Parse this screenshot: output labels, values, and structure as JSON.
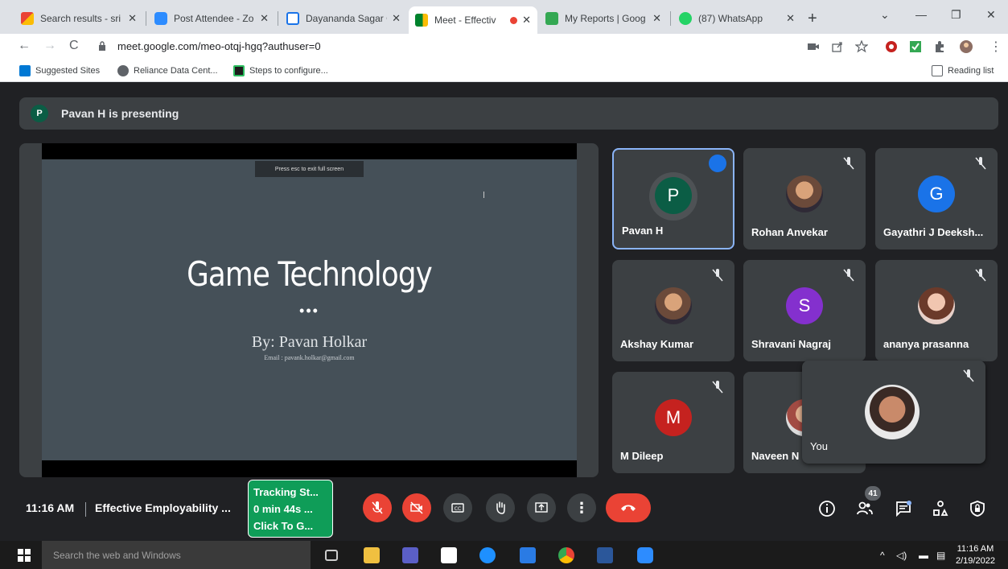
{
  "browser": {
    "tabs": [
      {
        "title": "Search results - sri",
        "icon": "gmail-icon",
        "color": "#ea4335"
      },
      {
        "title": "Post Attendee - Zo",
        "icon": "zoom-icon",
        "color": "#2d8cff"
      },
      {
        "title": "Dayananda Sagar C",
        "icon": "calendar-icon",
        "color": "#1a73e8"
      },
      {
        "title": "Meet - Effectiv",
        "icon": "meet-icon",
        "color": "#00832d",
        "active": true
      },
      {
        "title": "My Reports | Goog",
        "icon": "reports-icon",
        "color": "#34a853"
      },
      {
        "title": "(87) WhatsApp",
        "icon": "whatsapp-icon",
        "color": "#25d366"
      }
    ],
    "url": "meet.google.com/meo-otqj-hgq?authuser=0",
    "bookmarks": [
      {
        "label": "Suggested Sites",
        "icon": "bing-icon",
        "color": "#0078d4"
      },
      {
        "label": "Reliance Data Cent...",
        "icon": "globe-icon",
        "color": "#5f6368"
      },
      {
        "label": "Steps to configure...",
        "icon": "evernote-icon",
        "color": "#1d1d1d"
      }
    ],
    "reading_list": "Reading list"
  },
  "meet": {
    "presenter_initial": "P",
    "presenting_text": "Pavan H is presenting",
    "slide": {
      "esc_hint": "Press  esc  to exit full screen",
      "title": "Game Technology",
      "dots": "•••",
      "byline": "By: Pavan Holkar",
      "email": "Email : pavank.holkar@gmail.com"
    },
    "participants": [
      {
        "name": "Pavan H",
        "initial": "P",
        "color": "#0b5d45",
        "speaking": true
      },
      {
        "name": "Rohan Anvekar",
        "initial": "",
        "color": "#6b4a3a",
        "photo": true
      },
      {
        "name": "Gayathri J Deeksh...",
        "initial": "G",
        "color": "#1a73e8"
      },
      {
        "name": "Akshay Kumar",
        "initial": "",
        "color": "#4a3a30",
        "photo": true
      },
      {
        "name": "Shravani Nagraj",
        "initial": "S",
        "color": "#8430ce"
      },
      {
        "name": "ananya prasanna",
        "initial": "",
        "color": "#c48a70",
        "photo": true
      },
      {
        "name": "M Dileep",
        "initial": "M",
        "color": "#c5221f"
      },
      {
        "name": "Naveen N",
        "initial": "",
        "color": "#a24b43",
        "photo": true
      }
    ],
    "self_name": "You",
    "time": "11:16 AM",
    "meeting_title": "Effective Employability ...",
    "tracking": [
      "Tracking St...",
      "0 min 44s ...",
      "Click To G..."
    ],
    "people_count": "41"
  },
  "taskbar": {
    "search_placeholder": "Search the web and Windows",
    "clock_time": "11:16 AM",
    "clock_date": "2/19/2022"
  }
}
